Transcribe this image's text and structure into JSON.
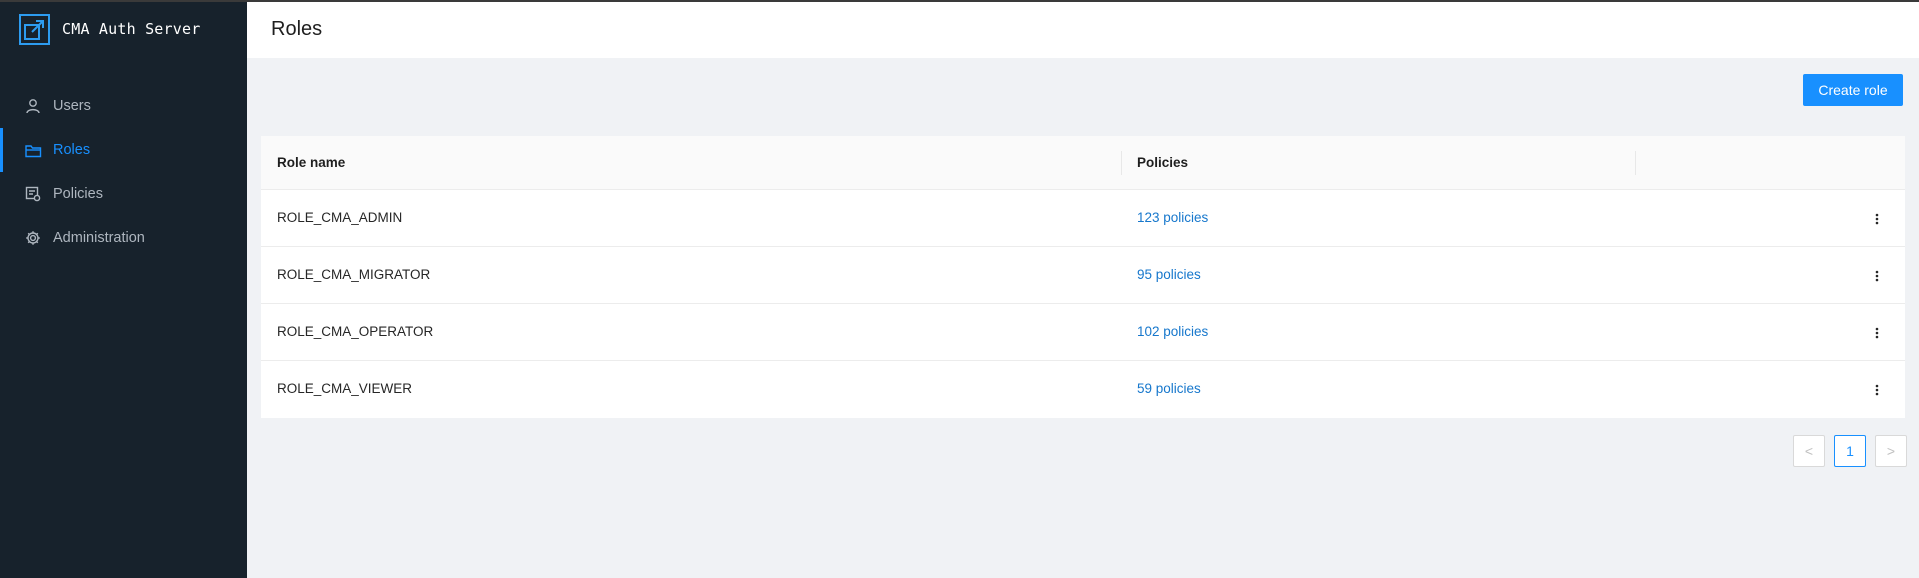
{
  "app": {
    "title": "CMA Auth Server",
    "logo_icon": "app-logo-icon"
  },
  "sidebar": {
    "items": [
      {
        "label": "Users",
        "icon": "user-icon",
        "active": false
      },
      {
        "label": "Roles",
        "icon": "folder-icon",
        "active": true
      },
      {
        "label": "Policies",
        "icon": "policy-icon",
        "active": false
      },
      {
        "label": "Administration",
        "icon": "gear-icon",
        "active": false
      }
    ]
  },
  "header": {
    "title": "Roles"
  },
  "toolbar": {
    "create_label": "Create role"
  },
  "table": {
    "columns": [
      "Role name",
      "Policies"
    ],
    "rows": [
      {
        "name": "ROLE_CMA_ADMIN",
        "policies": "123 policies"
      },
      {
        "name": "ROLE_CMA_MIGRATOR",
        "policies": "95 policies"
      },
      {
        "name": "ROLE_CMA_OPERATOR",
        "policies": "102 policies"
      },
      {
        "name": "ROLE_CMA_VIEWER",
        "policies": "59 policies"
      }
    ]
  },
  "pagination": {
    "prev": "<",
    "current": "1",
    "next": ">"
  },
  "colors": {
    "sidebar_bg": "#17222c",
    "accent": "#1890ff",
    "link": "#1677cc",
    "content_bg": "#f0f2f5"
  }
}
